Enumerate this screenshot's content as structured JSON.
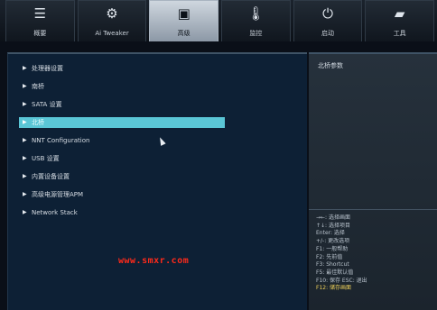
{
  "tabs": [
    {
      "label": "概要",
      "icon": "list-icon",
      "glyph": "☰",
      "active": false
    },
    {
      "label": "Ai Tweaker",
      "icon": "tweak-icon",
      "glyph": "⚙",
      "active": false
    },
    {
      "label": "高级",
      "icon": "advanced-icon",
      "glyph": "▣",
      "active": true
    },
    {
      "label": "监控",
      "icon": "thermometer-icon",
      "glyph": "🌡",
      "active": false
    },
    {
      "label": "启动",
      "icon": "power-icon",
      "glyph": "⏻",
      "active": false
    },
    {
      "label": "工具",
      "icon": "toolbox-icon",
      "glyph": "▰",
      "active": false
    }
  ],
  "menu": {
    "items": [
      {
        "label": "处理器设置"
      },
      {
        "label": "南桥"
      },
      {
        "label": "SATA 设置"
      },
      {
        "label": "北桥",
        "selected": true
      },
      {
        "label": "NNT Configuration"
      },
      {
        "label": "USB 设置"
      },
      {
        "label": "内置设备设置"
      },
      {
        "label": "高级电源管理APM"
      },
      {
        "label": "Network Stack"
      }
    ]
  },
  "side": {
    "title": "北桥参数",
    "help": [
      "→←: 选择画面",
      "↑↓: 选择项目",
      "Enter: 选择",
      "+/-: 更改选项",
      "F1: 一般帮助",
      "F2: 先前值",
      "F3: Shortcut",
      "F5: 最佳默认值",
      "F10: 保存  ESC: 退出",
      "F12: 储存画面"
    ]
  },
  "watermark": "www.smxr.com",
  "colors": {
    "background": "#0d2035",
    "selection": "#5ac6d6",
    "active_tab": "#cfd7df",
    "watermark": "#ff2a1a",
    "help_highlight": "#f0d25a"
  }
}
